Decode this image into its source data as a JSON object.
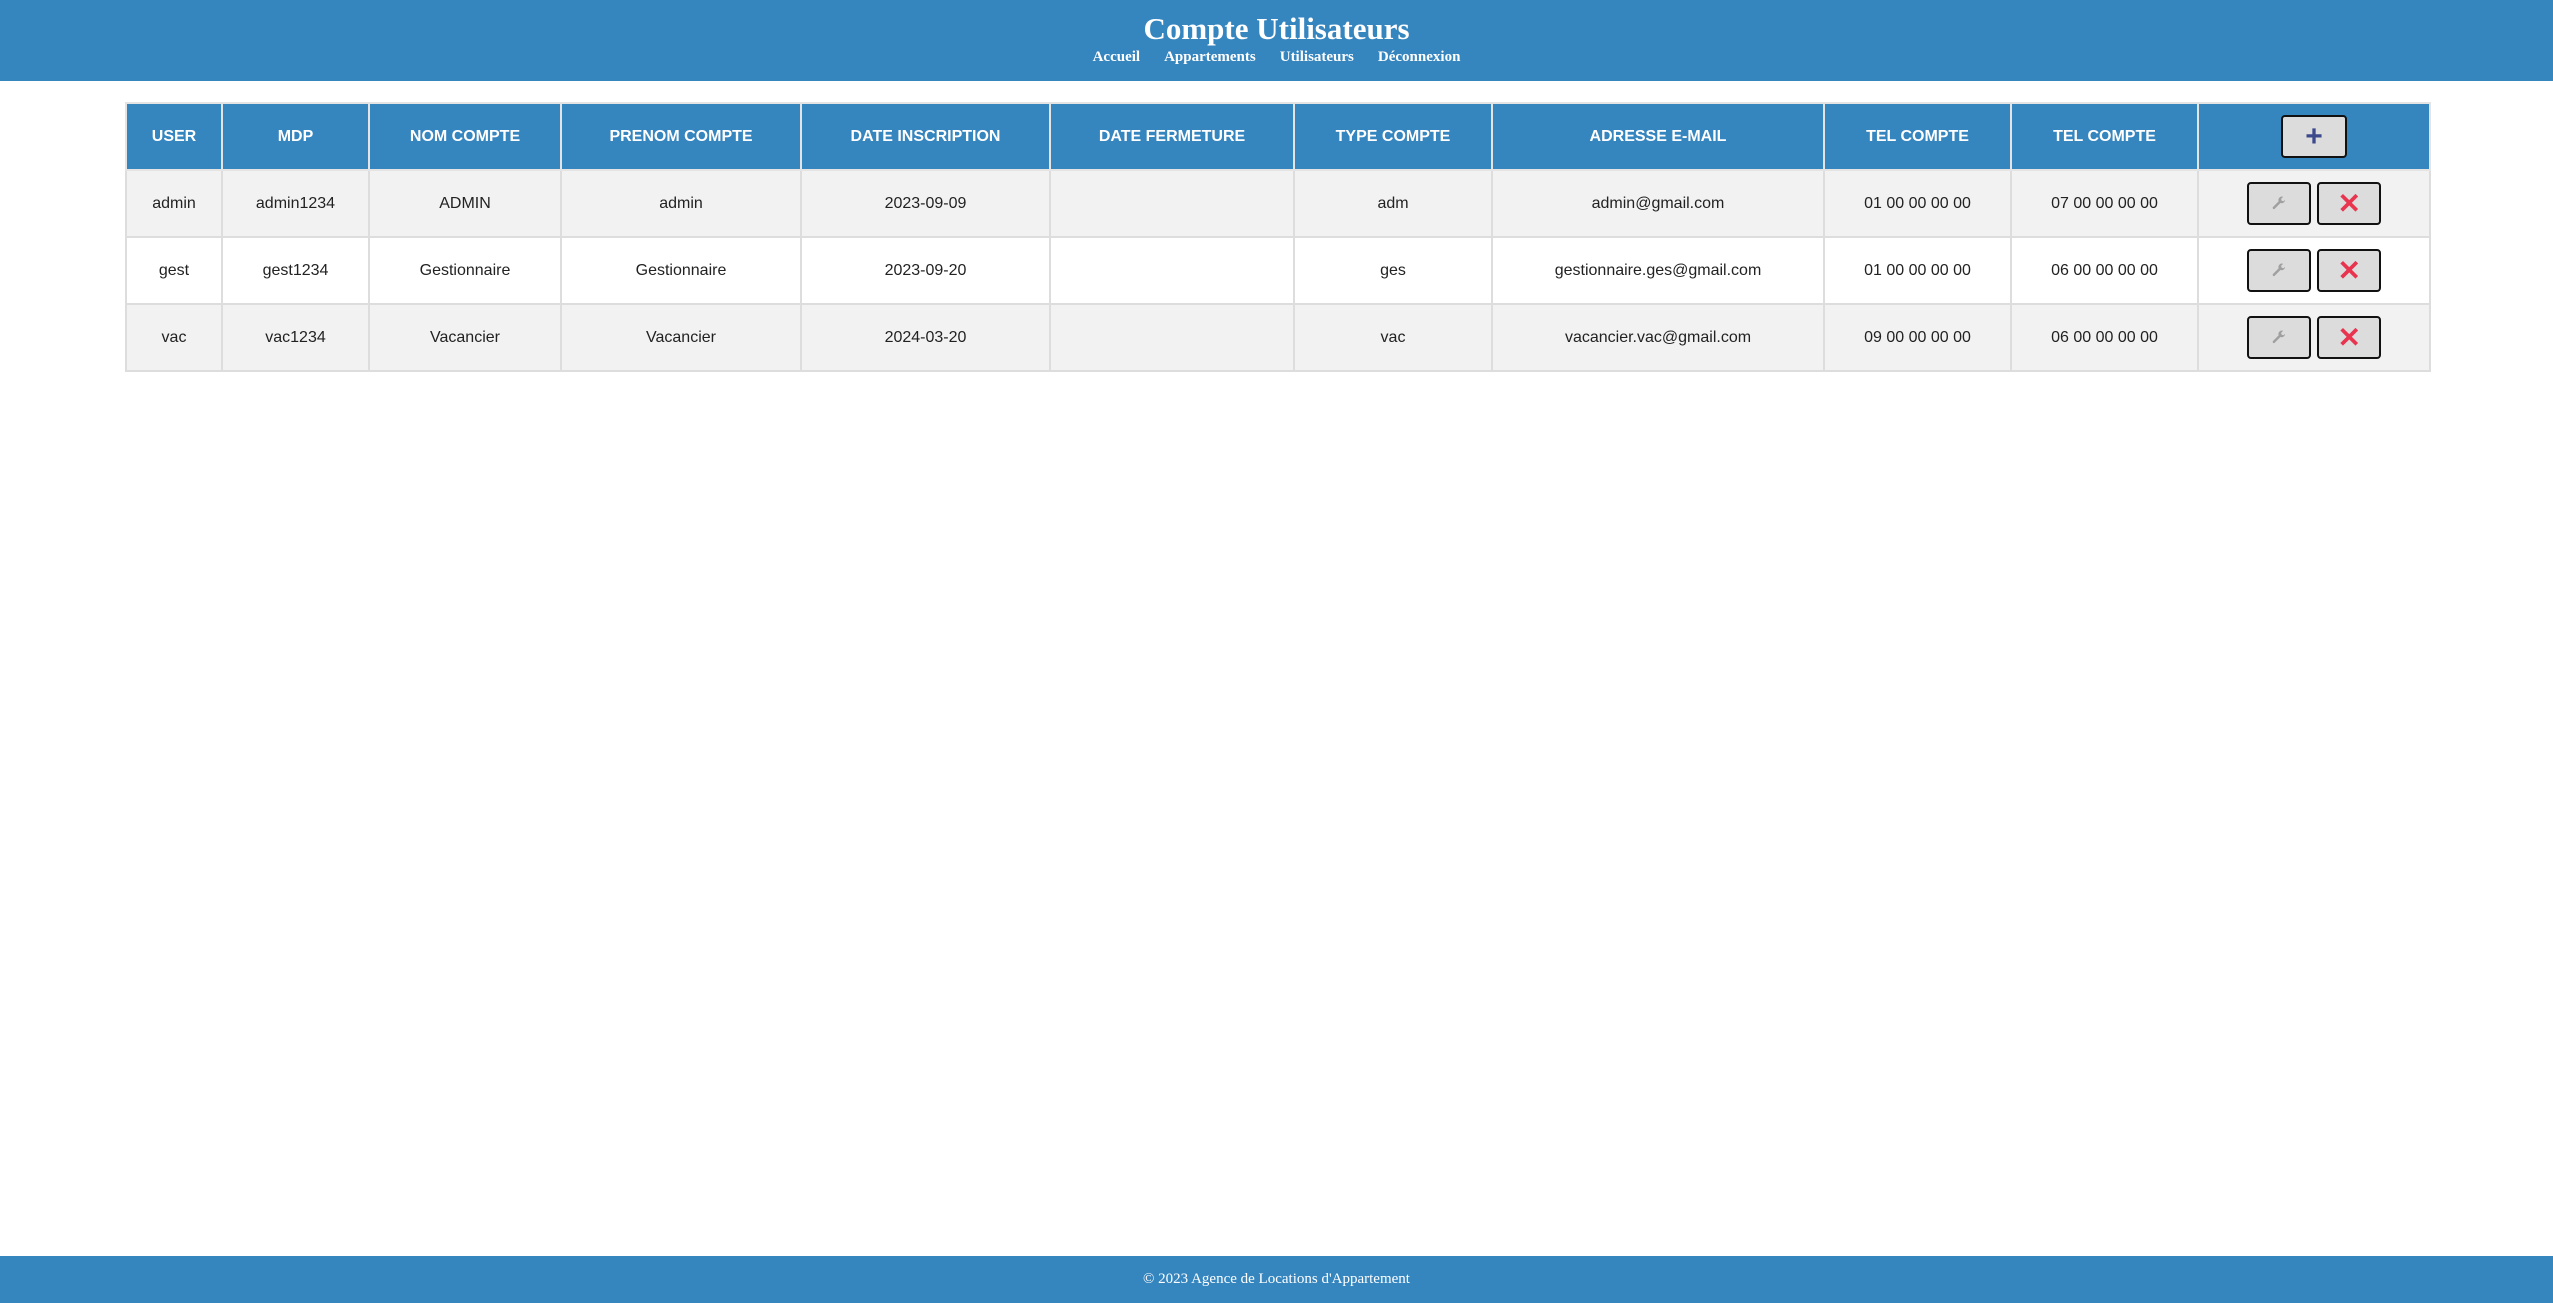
{
  "header": {
    "title": "Compte Utilisateurs",
    "nav": [
      "Accueil",
      "Appartements",
      "Utilisateurs",
      "Déconnexion"
    ]
  },
  "table": {
    "columns": [
      "USER",
      "MDP",
      "NOM COMPTE",
      "PRENOM COMPTE",
      "DATE INSCRIPTION",
      "DATE FERMETURE",
      "TYPE COMPTE",
      "ADRESSE E-MAIL",
      "TEL COMPTE",
      "TEL COMPTE"
    ],
    "add_icon": "+",
    "edit_icon": "wrench-icon",
    "delete_icon": "✕",
    "rows": [
      [
        "admin",
        "admin1234",
        "ADMIN",
        "admin",
        "2023-09-09",
        "",
        "adm",
        "admin@gmail.com",
        "01 00 00 00 00",
        "07 00 00 00 00"
      ],
      [
        "gest",
        "gest1234",
        "Gestionnaire",
        "Gestionnaire",
        "2023-09-20",
        "",
        "ges",
        "gestionnaire.ges@gmail.com",
        "01 00 00 00 00",
        "06 00 00 00 00"
      ],
      [
        "vac",
        "vac1234",
        "Vacancier",
        "Vacancier",
        "2024-03-20",
        "",
        "vac",
        "vacancier.vac@gmail.com",
        "09 00 00 00 00",
        "06 00 00 00 00"
      ]
    ]
  },
  "footer": {
    "text": "© 2023 Agence de Locations d'Appartement"
  },
  "colors": {
    "primary": "#3585bf",
    "delete": "#e8344e",
    "row_alt": "#f2f2f2"
  }
}
